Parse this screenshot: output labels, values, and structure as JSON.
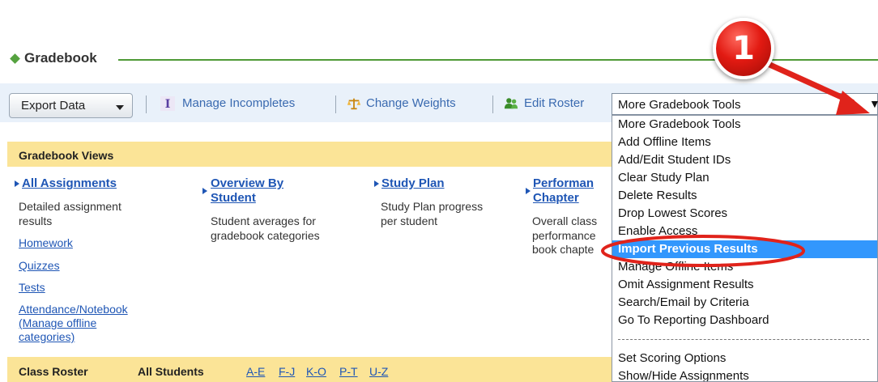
{
  "page": {
    "title": "Gradebook"
  },
  "toolbar": {
    "export_label": "Export Data",
    "manage_incompletes": "Manage Incompletes",
    "change_weights": "Change Weights",
    "edit_roster": "Edit Roster",
    "tools_select_value": "More Gradebook Tools",
    "tools_select_arrow": "▼"
  },
  "views": {
    "title": "Gradebook Views",
    "columns": [
      {
        "link": "All Assignments",
        "desc": [
          "Detailed assignment",
          "results"
        ],
        "sublinks": [
          "Homework",
          "Quizzes",
          "Tests",
          "Attendance/Notebook",
          "(Manage offline",
          "categories)"
        ]
      },
      {
        "link": [
          "Overview By",
          "Student"
        ],
        "desc": [
          "Student averages for",
          "gradebook categories"
        ]
      },
      {
        "link": "Study Plan",
        "desc": [
          "Study Plan progress",
          "per student"
        ]
      },
      {
        "link": [
          "Performan",
          "Chapter"
        ],
        "desc": [
          "Overall class",
          "performance",
          "book chapte"
        ]
      }
    ]
  },
  "roster": {
    "label": "Class Roster",
    "all_students": "All Students",
    "letters": [
      "A-E",
      "F-J",
      "K-O",
      "P-T",
      "U-Z"
    ]
  },
  "dropdown": {
    "items": [
      "More Gradebook Tools",
      "Add Offline Items",
      "Add/Edit Student IDs",
      "Clear Study Plan",
      "Delete Results",
      "Drop Lowest Scores",
      "Enable Access",
      "Import Previous Results",
      "Manage Offline Items",
      "Omit Assignment Results",
      "Search/Email by Criteria",
      "Go To Reporting Dashboard",
      "Set Scoring Options",
      "Show/Hide Assignments"
    ],
    "selected_index": 7
  },
  "callout": {
    "number": "1"
  },
  "colors": {
    "accent_green": "#4f9a37",
    "highlight_blue": "#3297fd",
    "callout_red": "#e21a12",
    "views_bar": "#fbe497"
  }
}
